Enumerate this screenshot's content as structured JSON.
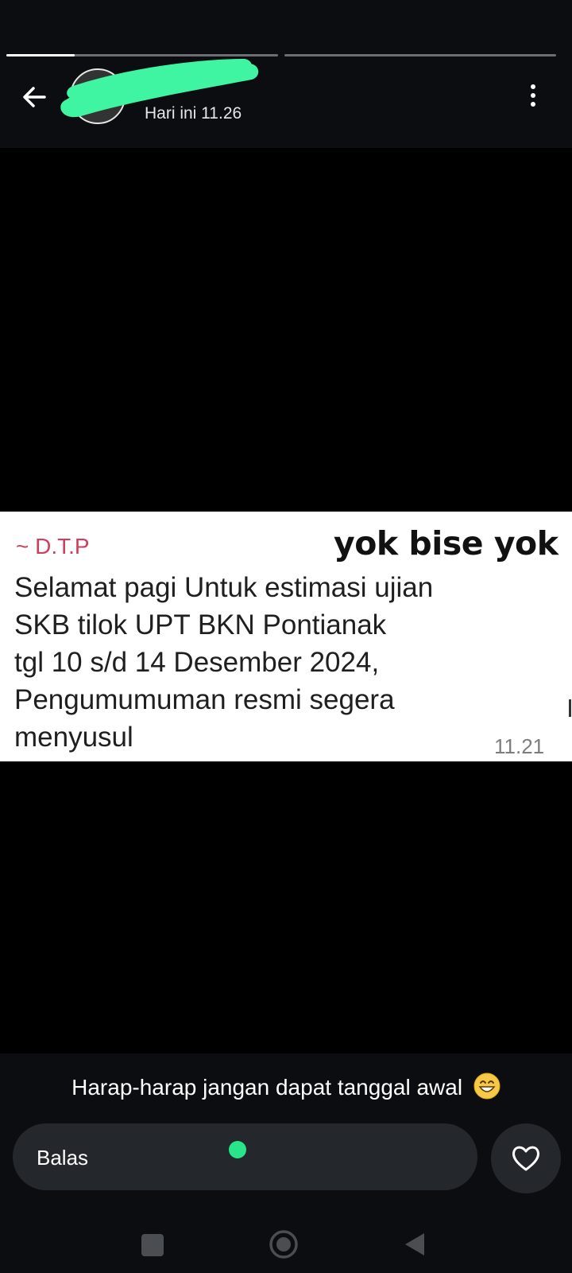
{
  "header": {
    "timestamp": "Hari ini 11.26",
    "progress": [
      1.0,
      0.0
    ],
    "active_segment_progress": 0.25
  },
  "message": {
    "sender": "~ D.T.P",
    "sticker_text": "yok bise yok",
    "lines": [
      "Selamat pagi Untuk estimasi ujian",
      "SKB tilok UPT BKN Pontianak",
      "tgl 10 s/d 14 Desember 2024,",
      "Pengumumuman resmi segera",
      "menyusul"
    ],
    "time": "11.21"
  },
  "footer": {
    "caption": "Harap-harap jangan dapat tanggal awal",
    "caption_emoji": "grinning-face-icon",
    "reply_label": "Balas",
    "like_icon": "heart-icon"
  },
  "colors": {
    "accent": "#29e58a",
    "redaction": "#3ff5a2",
    "sender": "#cf3e5c"
  }
}
